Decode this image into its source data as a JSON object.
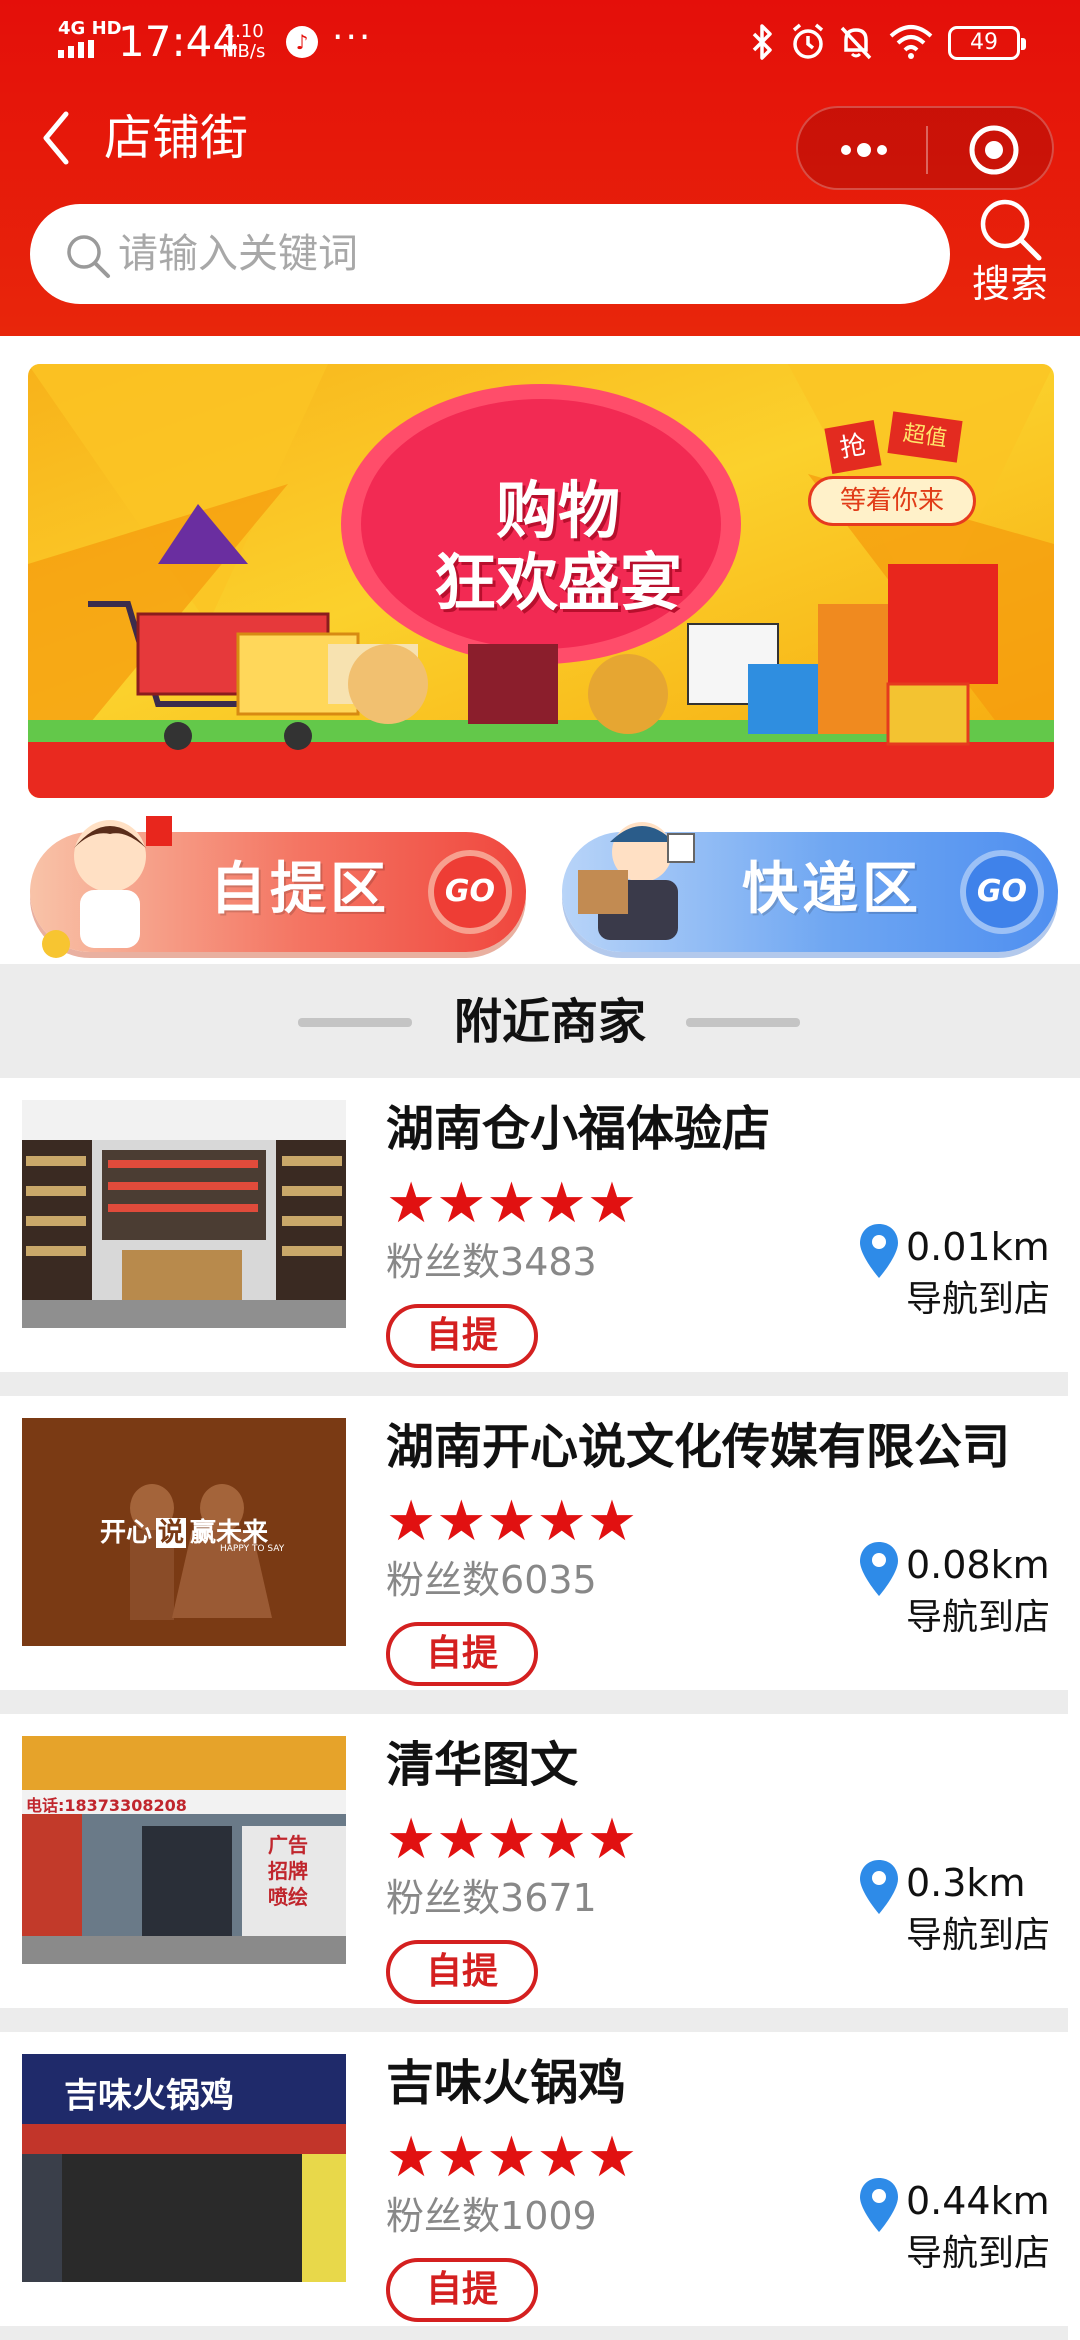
{
  "status_bar": {
    "network": "4G HD",
    "time": "17:44",
    "speed_value": "1.10",
    "speed_unit": "MB/s",
    "more": "···",
    "battery": "49"
  },
  "nav": {
    "title": "店铺街",
    "more_icon": "ellipsis-icon",
    "target_icon": "target-icon"
  },
  "search": {
    "placeholder": "请输入关键词",
    "button_label": "搜索"
  },
  "banner": {
    "title_line1": "购物",
    "title_line2": "狂欢盛宴",
    "tag": "等着你来",
    "ribbon1": "抢",
    "ribbon2": "超值"
  },
  "zones": [
    {
      "label": "自提区",
      "go": "GO",
      "color": "#f0473e"
    },
    {
      "label": "快递区",
      "go": "GO",
      "color": "#4f8ff0"
    }
  ],
  "section": {
    "title": "附近商家"
  },
  "merchants": [
    {
      "name": "湖南仓小福体验店",
      "stars": "★★★★★",
      "fans_label": "粉丝数",
      "fans": "3483",
      "tag": "自提",
      "distance": "0.01km",
      "nav": "导航到店"
    },
    {
      "name": "湖南开心说文化传媒有限公司",
      "stars": "★★★★★",
      "fans_label": "粉丝数",
      "fans": "6035",
      "tag": "自提",
      "distance": "0.08km",
      "nav": "导航到店",
      "thumb_text_left": "开心",
      "thumb_text_mid": "说",
      "thumb_text_right": "赢未来",
      "thumb_sub": "HAPPY TO SAY"
    },
    {
      "name": "清华图文",
      "stars": "★★★★★",
      "fans_label": "粉丝数",
      "fans": "3671",
      "tag": "自提",
      "distance": "0.3km",
      "nav": "导航到店",
      "thumb_phone": "电话:18373308208",
      "thumb_sign": "广告 招牌 喷绘"
    },
    {
      "name": "吉味火锅鸡",
      "stars": "★★★★★",
      "fans_label": "粉丝数",
      "fans": "1009",
      "tag": "自提",
      "distance": "0.44km",
      "nav": "导航到店",
      "thumb_sign": "吉味火锅鸡"
    }
  ],
  "colors": {
    "brand_red": "#e40f0a",
    "star_red": "#e11111",
    "pin_blue": "#2e8be8"
  }
}
